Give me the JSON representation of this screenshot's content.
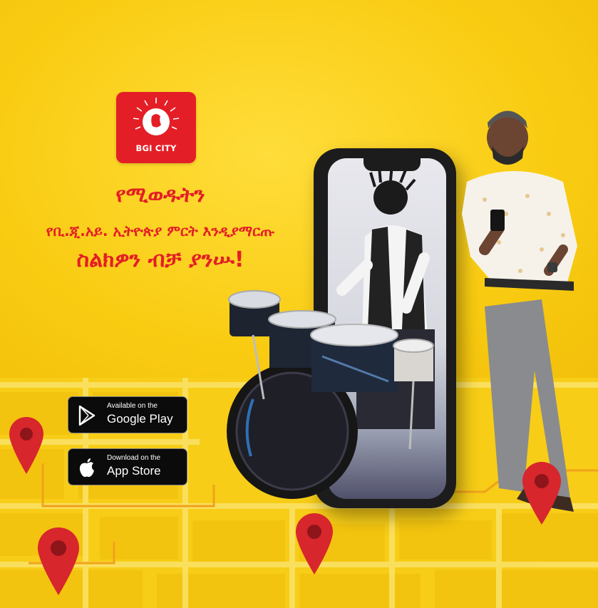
{
  "brand": {
    "logo_text": "BGI CITY",
    "color": "#e41e26"
  },
  "headline": {
    "line1": "የሚወዱትን",
    "line2": "የቢ.ጂ.አይ. ኢትዮጵያ ምርት እንዲያማርጡ",
    "line3": "ስልክዎን ብቻ ያንሡ!"
  },
  "stores": {
    "google_play": {
      "small": "Available on the",
      "big": "Google Play",
      "icon": "google-play-icon"
    },
    "app_store": {
      "small": "Download on the",
      "big": "App Store",
      "icon": "apple-icon"
    }
  },
  "colors": {
    "background": "#ffd21a",
    "map_road": "#f8df4f",
    "pin": "#d7262c"
  }
}
